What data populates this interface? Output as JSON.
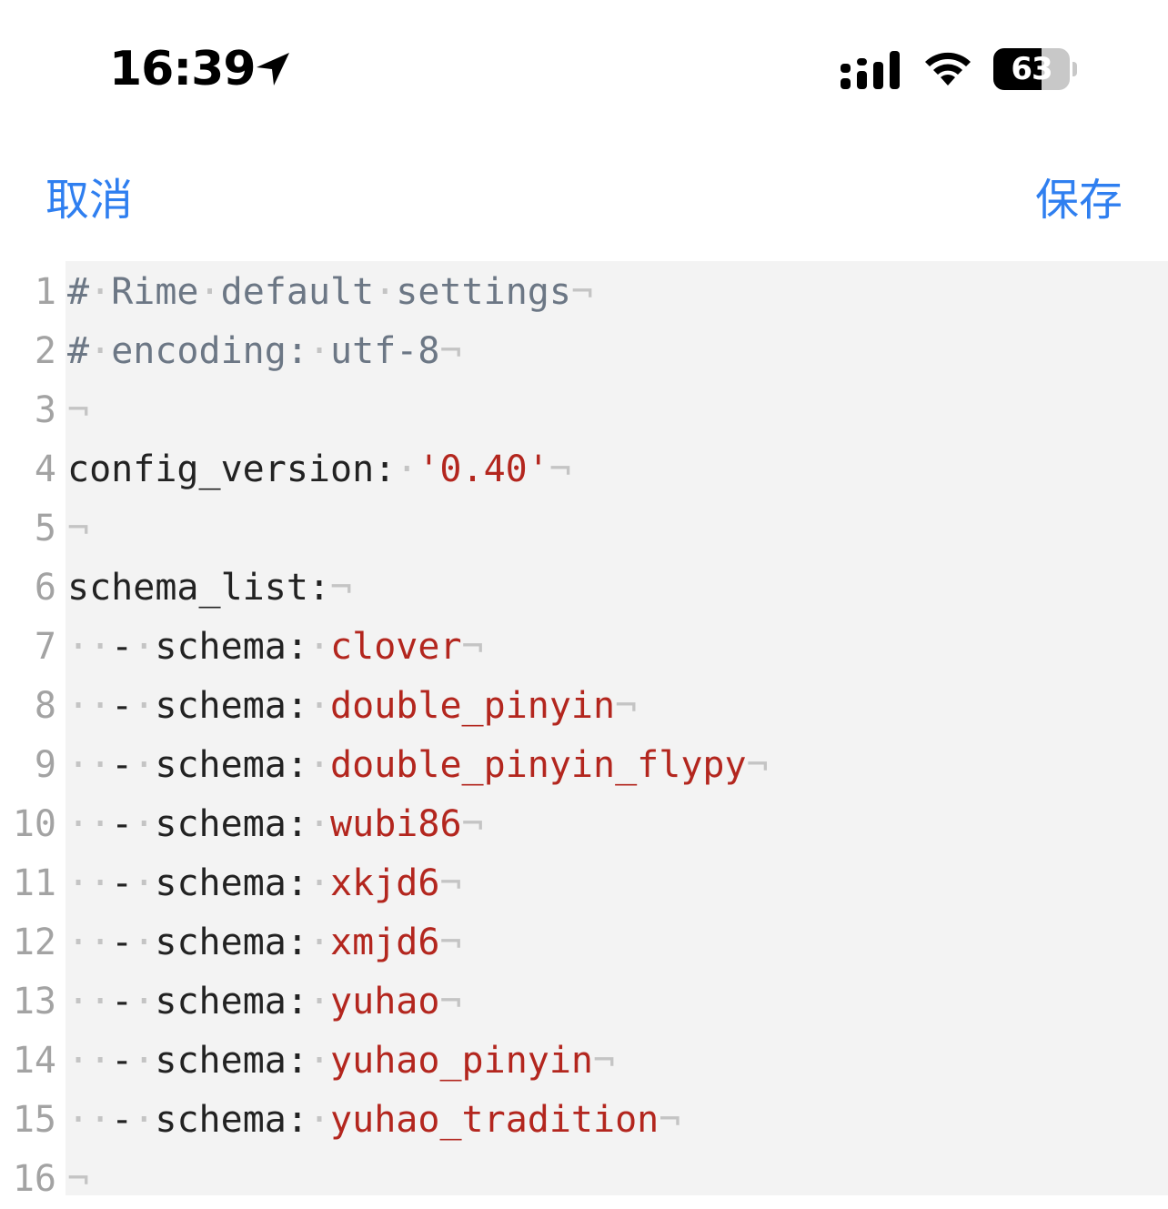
{
  "status_bar": {
    "time": "16:39",
    "battery_level": "63",
    "battery_percent": 63,
    "icons": [
      "location-arrow-icon",
      "cellular-signal-icon",
      "wifi-icon",
      "battery-icon"
    ]
  },
  "nav": {
    "cancel_label": "取消",
    "save_label": "保存",
    "accent_color": "#2f7ff0"
  },
  "editor": {
    "colors": {
      "comment": "#6c7785",
      "key": "#222222",
      "string": "#b3261e",
      "line_number": "#a3a3a3",
      "background": "#f3f3f3"
    },
    "lines": [
      {
        "num": "1",
        "segments": [
          [
            "comment",
            "#"
          ],
          [
            "ws",
            "·"
          ],
          [
            "comment",
            "Rime"
          ],
          [
            "ws",
            "·"
          ],
          [
            "comment",
            "default"
          ],
          [
            "ws",
            "·"
          ],
          [
            "comment",
            "settings"
          ],
          [
            "eol",
            "¬"
          ]
        ]
      },
      {
        "num": "2",
        "segments": [
          [
            "comment",
            "#"
          ],
          [
            "ws",
            "·"
          ],
          [
            "comment",
            "encoding:"
          ],
          [
            "ws",
            "·"
          ],
          [
            "comment",
            "utf-8"
          ],
          [
            "eol",
            "¬"
          ]
        ]
      },
      {
        "num": "3",
        "segments": [
          [
            "eol",
            "¬"
          ]
        ]
      },
      {
        "num": "4",
        "segments": [
          [
            "key",
            "config_version:"
          ],
          [
            "ws",
            "·"
          ],
          [
            "str",
            "'0.40'"
          ],
          [
            "eol",
            "¬"
          ]
        ]
      },
      {
        "num": "5",
        "segments": [
          [
            "eol",
            "¬"
          ]
        ]
      },
      {
        "num": "6",
        "segments": [
          [
            "key",
            "schema_list:"
          ],
          [
            "eol",
            "¬"
          ]
        ]
      },
      {
        "num": "7",
        "segments": [
          [
            "ws",
            "··"
          ],
          [
            "key",
            "-"
          ],
          [
            "ws",
            "·"
          ],
          [
            "key",
            "schema:"
          ],
          [
            "ws",
            "·"
          ],
          [
            "str",
            "clover"
          ],
          [
            "eol",
            "¬"
          ]
        ]
      },
      {
        "num": "8",
        "segments": [
          [
            "ws",
            "··"
          ],
          [
            "key",
            "-"
          ],
          [
            "ws",
            "·"
          ],
          [
            "key",
            "schema:"
          ],
          [
            "ws",
            "·"
          ],
          [
            "str",
            "double_pinyin"
          ],
          [
            "eol",
            "¬"
          ]
        ]
      },
      {
        "num": "9",
        "segments": [
          [
            "ws",
            "··"
          ],
          [
            "key",
            "-"
          ],
          [
            "ws",
            "·"
          ],
          [
            "key",
            "schema:"
          ],
          [
            "ws",
            "·"
          ],
          [
            "str",
            "double_pinyin_flypy"
          ],
          [
            "eol",
            "¬"
          ]
        ]
      },
      {
        "num": "10",
        "segments": [
          [
            "ws",
            "··"
          ],
          [
            "key",
            "-"
          ],
          [
            "ws",
            "·"
          ],
          [
            "key",
            "schema:"
          ],
          [
            "ws",
            "·"
          ],
          [
            "str",
            "wubi86"
          ],
          [
            "eol",
            "¬"
          ]
        ]
      },
      {
        "num": "11",
        "segments": [
          [
            "ws",
            "··"
          ],
          [
            "key",
            "-"
          ],
          [
            "ws",
            "·"
          ],
          [
            "key",
            "schema:"
          ],
          [
            "ws",
            "·"
          ],
          [
            "str",
            "xkjd6"
          ],
          [
            "eol",
            "¬"
          ]
        ]
      },
      {
        "num": "12",
        "segments": [
          [
            "ws",
            "··"
          ],
          [
            "key",
            "-"
          ],
          [
            "ws",
            "·"
          ],
          [
            "key",
            "schema:"
          ],
          [
            "ws",
            "·"
          ],
          [
            "str",
            "xmjd6"
          ],
          [
            "eol",
            "¬"
          ]
        ]
      },
      {
        "num": "13",
        "segments": [
          [
            "ws",
            "··"
          ],
          [
            "key",
            "-"
          ],
          [
            "ws",
            "·"
          ],
          [
            "key",
            "schema:"
          ],
          [
            "ws",
            "·"
          ],
          [
            "str",
            "yuhao"
          ],
          [
            "eol",
            "¬"
          ]
        ]
      },
      {
        "num": "14",
        "segments": [
          [
            "ws",
            "··"
          ],
          [
            "key",
            "-"
          ],
          [
            "ws",
            "·"
          ],
          [
            "key",
            "schema:"
          ],
          [
            "ws",
            "·"
          ],
          [
            "str",
            "yuhao_pinyin"
          ],
          [
            "eol",
            "¬"
          ]
        ]
      },
      {
        "num": "15",
        "segments": [
          [
            "ws",
            "··"
          ],
          [
            "key",
            "-"
          ],
          [
            "ws",
            "·"
          ],
          [
            "key",
            "schema:"
          ],
          [
            "ws",
            "·"
          ],
          [
            "str",
            "yuhao_tradition"
          ],
          [
            "eol",
            "¬"
          ]
        ]
      },
      {
        "num": "16",
        "segments": [
          [
            "eol",
            "¬"
          ]
        ]
      }
    ]
  }
}
